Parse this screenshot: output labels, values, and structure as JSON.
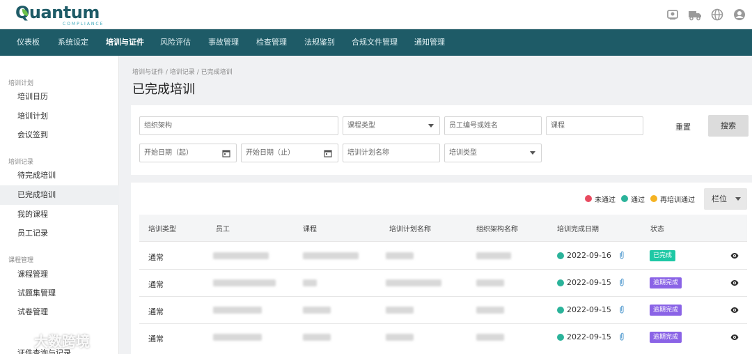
{
  "brand": {
    "name": "Quantum",
    "sub": "COMPLIANCE"
  },
  "nav": [
    "仪表板",
    "系统设定",
    "培训与证件",
    "风险评估",
    "事故管理",
    "检查管理",
    "法规鉴别",
    "合规文件管理",
    "通知管理"
  ],
  "sidebar": {
    "groups": [
      {
        "title": "培训计划",
        "items": [
          "培训日历",
          "培训计划",
          "会议签到"
        ]
      },
      {
        "title": "培训记录",
        "items": [
          "待完成培训",
          "已完成培训",
          "我的课程",
          "员工记录"
        ]
      },
      {
        "title": "课程管理",
        "items": [
          "课程管理",
          "试题集管理",
          "试卷管理"
        ]
      }
    ],
    "partial_item": "证件查询与记录"
  },
  "breadcrumb": [
    "培训与证件",
    "培训记录",
    "已完成培训"
  ],
  "page_title": "已完成培训",
  "filters": {
    "org": "组织架构",
    "course_type": "课程类型",
    "employee": "员工编号或姓名",
    "course": "课程",
    "start_from": "开始日期（起）",
    "start_to": "开始日期（止）",
    "plan_name": "培训计划名称",
    "training_type": "培训类型",
    "reset": "重置",
    "search": "搜索"
  },
  "legend": [
    {
      "label": "未通过",
      "color": "#e84a5f"
    },
    {
      "label": "通过",
      "color": "#2bb39a"
    },
    {
      "label": "再培训通过",
      "color": "#f5b323"
    }
  ],
  "columns_button": "栏位",
  "table": {
    "headers": [
      "培训类型",
      "员工",
      "课程",
      "培训计划名称",
      "组织架构名称",
      "培训完成日期",
      "状态"
    ],
    "rows": [
      {
        "type": "通常",
        "date": "2022-09-16",
        "status": "已完成",
        "status_color": "#1ec8a5"
      },
      {
        "type": "通常",
        "date": "2022-09-15",
        "status": "逾期完成",
        "status_color": "#8a63e6"
      },
      {
        "type": "通常",
        "date": "2022-09-15",
        "status": "逾期完成",
        "status_color": "#8a63e6"
      },
      {
        "type": "通常",
        "date": "2022-09-15",
        "status": "逾期完成",
        "status_color": "#8a63e6"
      }
    ]
  },
  "watermark": "大数跨境"
}
